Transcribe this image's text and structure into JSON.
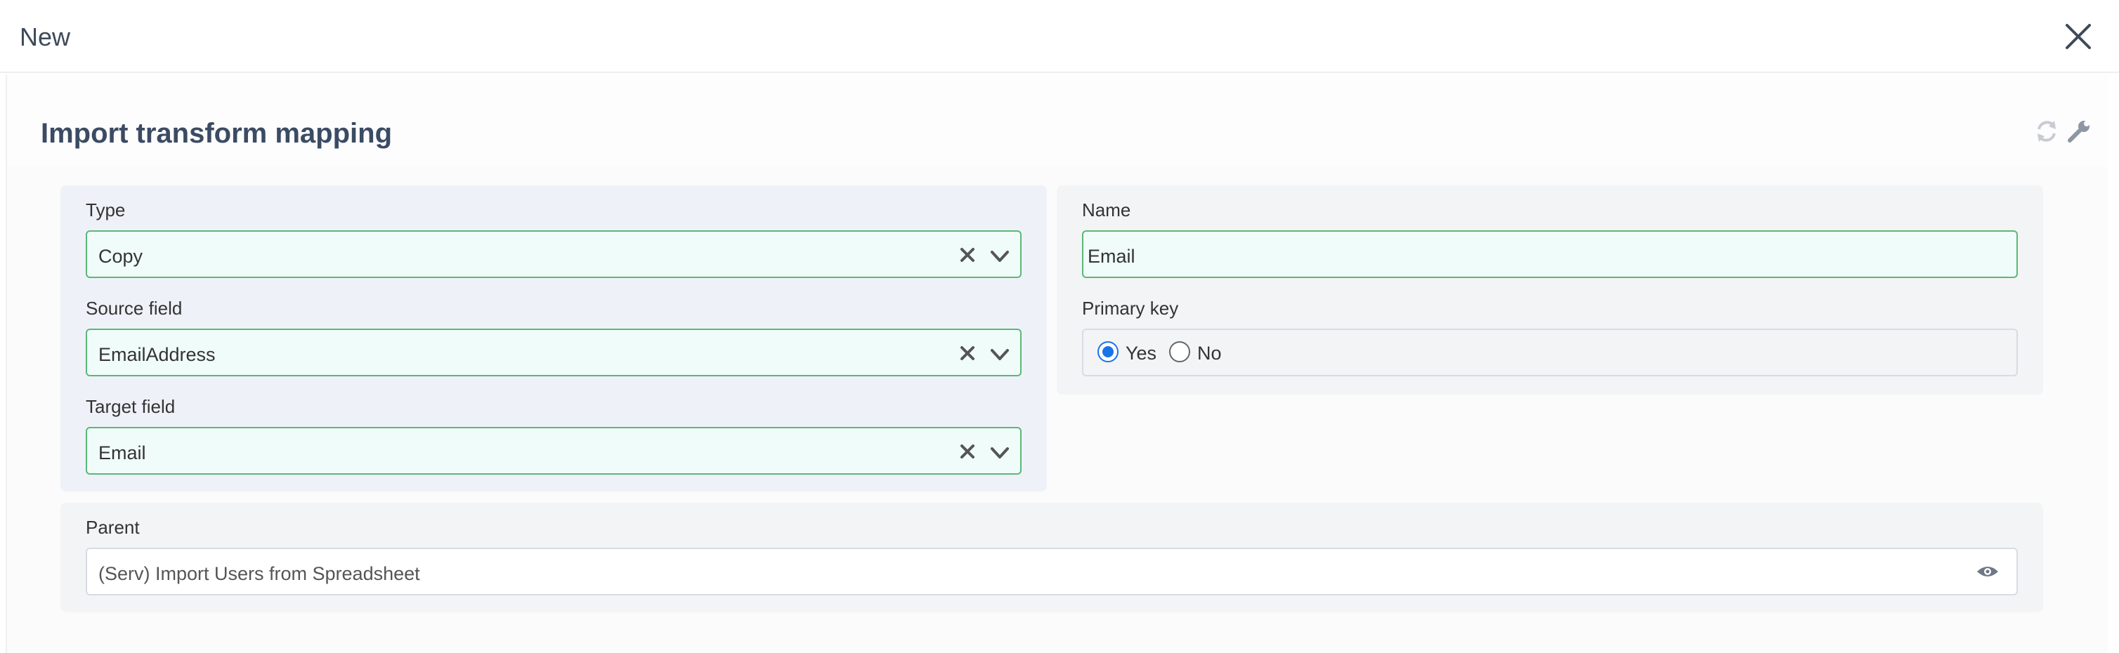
{
  "modal": {
    "title": "New",
    "close_icon": "close-icon"
  },
  "form": {
    "title": "Import transform mapping",
    "tools": [
      "refresh-icon",
      "wrench-icon"
    ]
  },
  "fields": {
    "type": {
      "label": "Type",
      "value": "Copy"
    },
    "source_field": {
      "label": "Source field",
      "value": "EmailAddress"
    },
    "target_field": {
      "label": "Target field",
      "value": "Email"
    },
    "name": {
      "label": "Name",
      "value": "Email"
    },
    "primary_key": {
      "label": "Primary key",
      "options": [
        {
          "label": "Yes",
          "selected": true
        },
        {
          "label": "No",
          "selected": false
        }
      ]
    },
    "parent": {
      "label": "Parent",
      "value": "(Serv) Import Users from Spreadsheet"
    }
  },
  "colors": {
    "field_border_valid": "#5cb777",
    "field_bg_valid": "#f0fcf9",
    "title_color": "#3b4b63",
    "radio_accent": "#1a73e8"
  }
}
